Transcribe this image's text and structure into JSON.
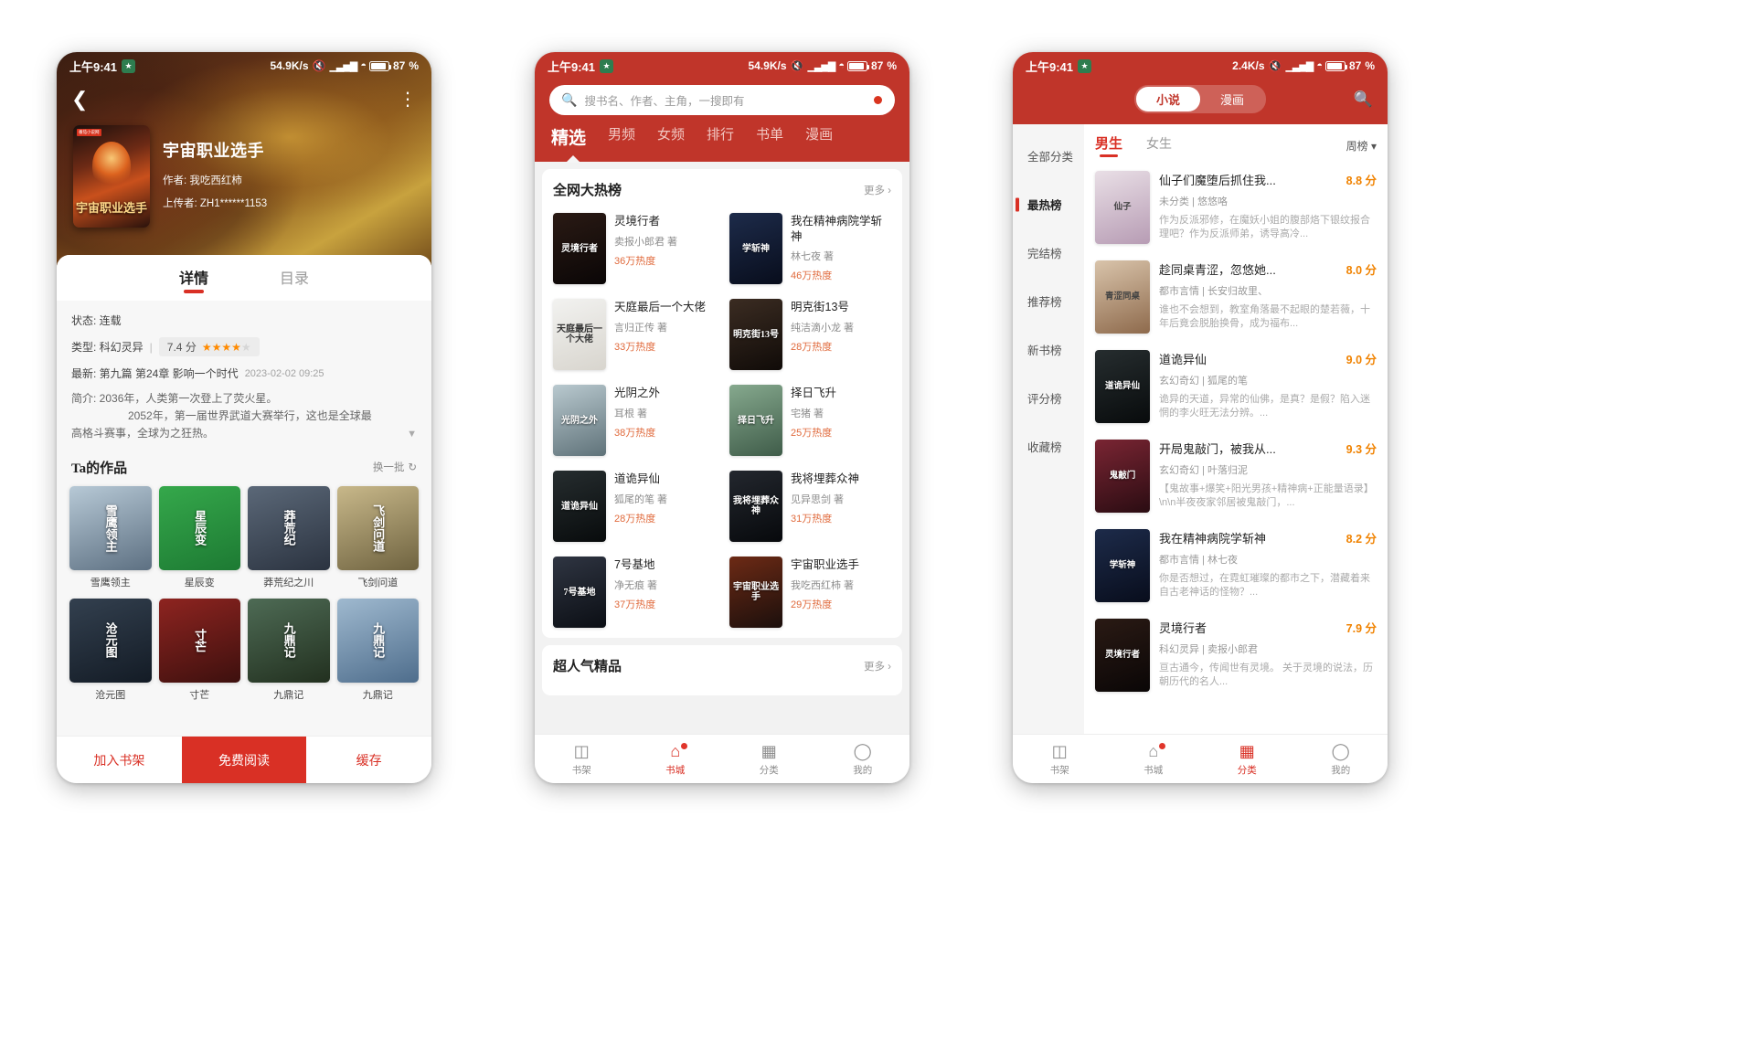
{
  "status_bar": {
    "time": "上午9:41",
    "net_1": "54.9K/s",
    "net_2": "54.9K/s",
    "net_3": "2.4K/s",
    "battery": "87",
    "battery_unit": "%"
  },
  "phone1": {
    "nav": {
      "back_icon": "chevron-left-icon",
      "menu_icon": "more-vertical-icon"
    },
    "book": {
      "cover_text": "宇宙职业选手",
      "cover_tag": "番茄小说网",
      "title": "宇宙职业选手",
      "author_line": "作者: 我吃西红柿",
      "uploader_line": "上传者: ZH1******1153"
    },
    "tabs": [
      {
        "label": "详情",
        "active": true
      },
      {
        "label": "目录",
        "active": false
      }
    ],
    "info": {
      "status_label": "状态: 连载",
      "type_label": "类型: 科幻灵异",
      "separator": "|",
      "score": "7.4 分",
      "stars_full": 4,
      "stars_empty": 1,
      "latest_label": "最新: 第九篇 第24章 影响一个时代",
      "latest_date": "2023-02-02 09:25",
      "intro_line1": "简介: 2036年，人类第一次登上了荧火星。",
      "intro_line2": "2052年，第一届世界武道大赛举行，这也是全球最",
      "intro_line3": "高格斗赛事，全球为之狂热。",
      "expand_icon": "chevron-down-icon"
    },
    "works": {
      "heading": "Ta的作品",
      "refresh_label": "换一批",
      "refresh_icon": "refresh-icon",
      "items": [
        {
          "title": "雪鹰领主",
          "cover_text": "雪鹰领主",
          "c1": "#b7c9d6",
          "c2": "#5d7082"
        },
        {
          "title": "星辰变",
          "cover_text": "星辰变",
          "c1": "#35a84b",
          "c2": "#1d7a33"
        },
        {
          "title": "莽荒纪之川",
          "cover_text": "莽荒纪",
          "c1": "#5b6878",
          "c2": "#2b3340"
        },
        {
          "title": "飞剑问道",
          "cover_text": "飞剑问道",
          "c1": "#c8b88a",
          "c2": "#6f6340"
        },
        {
          "title": "沧元图",
          "cover_text": "沧元图",
          "c1": "#33404f",
          "c2": "#131b25"
        },
        {
          "title": "寸芒",
          "cover_text": "寸芒",
          "c1": "#8e2420",
          "c2": "#3d100e"
        },
        {
          "title": "九鼎记",
          "cover_text": "九鼎记",
          "c1": "#4e6b55",
          "c2": "#22301f"
        },
        {
          "title": "九鼎记",
          "cover_text": "九鼎记",
          "c1": "#9fb9cf",
          "c2": "#4e6d8c"
        }
      ]
    },
    "actions": [
      {
        "label": "加入书架",
        "style": "shelf"
      },
      {
        "label": "免费阅读",
        "style": "read"
      },
      {
        "label": "缓存",
        "style": "cache"
      }
    ]
  },
  "phone2": {
    "search": {
      "placeholder": "搜书名、作者、主角，一搜即有",
      "icon": "search-icon",
      "dot": true
    },
    "tabs": [
      {
        "label": "精选",
        "active": true
      },
      {
        "label": "男频",
        "active": false
      },
      {
        "label": "女频",
        "active": false
      },
      {
        "label": "排行",
        "active": false
      },
      {
        "label": "书单",
        "active": false
      },
      {
        "label": "漫画",
        "active": false
      }
    ],
    "section1": {
      "heading": "全网大热榜",
      "more": "更多",
      "more_icon": "chevron-right-icon",
      "books": [
        {
          "title": "灵境行者",
          "author": "卖报小郎君 著",
          "heat": "36万热度",
          "cover_text": "灵境行者",
          "c1": "#2a1a14",
          "c2": "#0a0606"
        },
        {
          "title": "我在精神病院学斩神",
          "author": "林七夜 著",
          "heat": "46万热度",
          "cover_text": "学斩神",
          "c1": "#1d2b4a",
          "c2": "#080d1c"
        },
        {
          "title": "天庭最后一个大佬",
          "author": "言归正传 著",
          "heat": "33万热度",
          "cover_text": "天庭最后一个大佬",
          "c1": "#f2f2f0",
          "c2": "#d8d5ce"
        },
        {
          "title": "明克街13号",
          "author": "纯洁滴小龙 著",
          "heat": "28万热度",
          "cover_text": "明克街13号",
          "c1": "#3b2c22",
          "c2": "#100b08"
        },
        {
          "title": "光阴之外",
          "author": "耳根 著",
          "heat": "38万热度",
          "cover_text": "光阴之外",
          "c1": "#b9c9cf",
          "c2": "#5f7279"
        },
        {
          "title": "择日飞升",
          "author": "宅猪 著",
          "heat": "25万热度",
          "cover_text": "择日飞升",
          "c1": "#86a98e",
          "c2": "#3f5c49"
        },
        {
          "title": "道诡异仙",
          "author": "狐尾的笔 著",
          "heat": "28万热度",
          "cover_text": "道诡异仙",
          "c1": "#262d2f",
          "c2": "#080b0c"
        },
        {
          "title": "我将埋葬众神",
          "author": "见异思剑 著",
          "heat": "31万热度",
          "cover_text": "我将埋葬众神",
          "c1": "#23272e",
          "c2": "#07090c"
        },
        {
          "title": "7号基地",
          "author": "净无痕 著",
          "heat": "37万热度",
          "cover_text": "7号基地",
          "c1": "#2f3542",
          "c2": "#0b0e14"
        },
        {
          "title": "宇宙职业选手",
          "author": "我吃西红柿 著",
          "heat": "29万热度",
          "cover_text": "宇宙职业选手",
          "c1": "#6d2a15",
          "c2": "#1b0f0c"
        }
      ]
    },
    "section2": {
      "heading": "超人气精品",
      "more": "更多",
      "more_icon": "chevron-right-icon"
    },
    "tabbar": [
      {
        "label": "书架",
        "icon": "bookshelf-icon",
        "active": false,
        "dot": false
      },
      {
        "label": "书城",
        "icon": "home-icon",
        "active": true,
        "dot": true
      },
      {
        "label": "分类",
        "icon": "grid-icon",
        "active": false,
        "dot": false
      },
      {
        "label": "我的",
        "icon": "user-icon",
        "active": false,
        "dot": false
      }
    ]
  },
  "phone3": {
    "segments": [
      {
        "label": "小说",
        "active": true
      },
      {
        "label": "漫画",
        "active": false
      }
    ],
    "search_icon": "search-icon",
    "sidebar": [
      {
        "label": "全部分类",
        "active": false
      },
      {
        "label": "最热榜",
        "active": true
      },
      {
        "label": "完结榜",
        "active": false
      },
      {
        "label": "推荐榜",
        "active": false
      },
      {
        "label": "新书榜",
        "active": false
      },
      {
        "label": "评分榜",
        "active": false
      },
      {
        "label": "收藏榜",
        "active": false
      }
    ],
    "main_tabs": [
      {
        "label": "男生",
        "active": true
      },
      {
        "label": "女生",
        "active": false
      }
    ],
    "period": "周榜",
    "period_icon": "chevron-down-icon",
    "books": [
      {
        "title": "仙子们魔堕后抓住我...",
        "score": "8.8 分",
        "meta": "未分类 | 悠悠咯",
        "desc": "作为反派邪修，在魔妖小姐的腹部烙下银纹报合理吧？作为反派师弟，诱导高冷...",
        "cover_text": "仙子",
        "c1": "#e9dfe6",
        "c2": "#b79cb4"
      },
      {
        "title": "趁同桌青涩，忽悠她...",
        "score": "8.0 分",
        "meta": "都市言情 | 长安归故里、",
        "desc": "谁也不会想到，教室角落最不起眼的楚若薇，十年后竟会脱胎换骨，成为福布...",
        "cover_text": "青涩同桌",
        "c1": "#d9c4ab",
        "c2": "#8e6a4c"
      },
      {
        "title": "道诡异仙",
        "score": "9.0 分",
        "meta": "玄幻奇幻 | 狐尾的笔",
        "desc": "诡异的天道，异常的仙佛，是真？是假？陷入迷惘的李火旺无法分辨。...",
        "cover_text": "道诡异仙",
        "c1": "#262d2f",
        "c2": "#080b0c"
      },
      {
        "title": "开局鬼敲门，被我从...",
        "score": "9.3 分",
        "meta": "玄幻奇幻 | 叶落归泥",
        "desc": "【鬼故事+爆笑+阳光男孩+精神病+正能量语录】\\n\\n半夜夜家邻居被鬼敲门，...",
        "cover_text": "鬼敲门",
        "c1": "#7a2533",
        "c2": "#2a0c12"
      },
      {
        "title": "我在精神病院学斩神",
        "score": "8.2 分",
        "meta": "都市言情 | 林七夜",
        "desc": "你是否想过，在霓虹璀璨的都市之下，潜藏着来自古老神话的怪物？...",
        "cover_text": "学斩神",
        "c1": "#1d2b4a",
        "c2": "#080d1c"
      },
      {
        "title": "灵境行者",
        "score": "7.9 分",
        "meta": "科幻灵异 | 卖报小郎君",
        "desc": "亘古通今，传闻世有灵境。\n关于灵境的说法，历朝历代的名人...",
        "cover_text": "灵境行者",
        "c1": "#2a1a14",
        "c2": "#0a0606"
      }
    ],
    "tabbar": [
      {
        "label": "书架",
        "icon": "bookshelf-icon",
        "active": false,
        "dot": false
      },
      {
        "label": "书城",
        "icon": "home-icon",
        "active": false,
        "dot": true
      },
      {
        "label": "分类",
        "icon": "grid-icon",
        "active": true,
        "dot": false
      },
      {
        "label": "我的",
        "icon": "user-icon",
        "active": false,
        "dot": false
      }
    ]
  },
  "colors": {
    "brand_red": "#c0352a",
    "accent_red": "#d93025",
    "score_orange": "#f08200",
    "heat_orange": "#e06a3c"
  }
}
